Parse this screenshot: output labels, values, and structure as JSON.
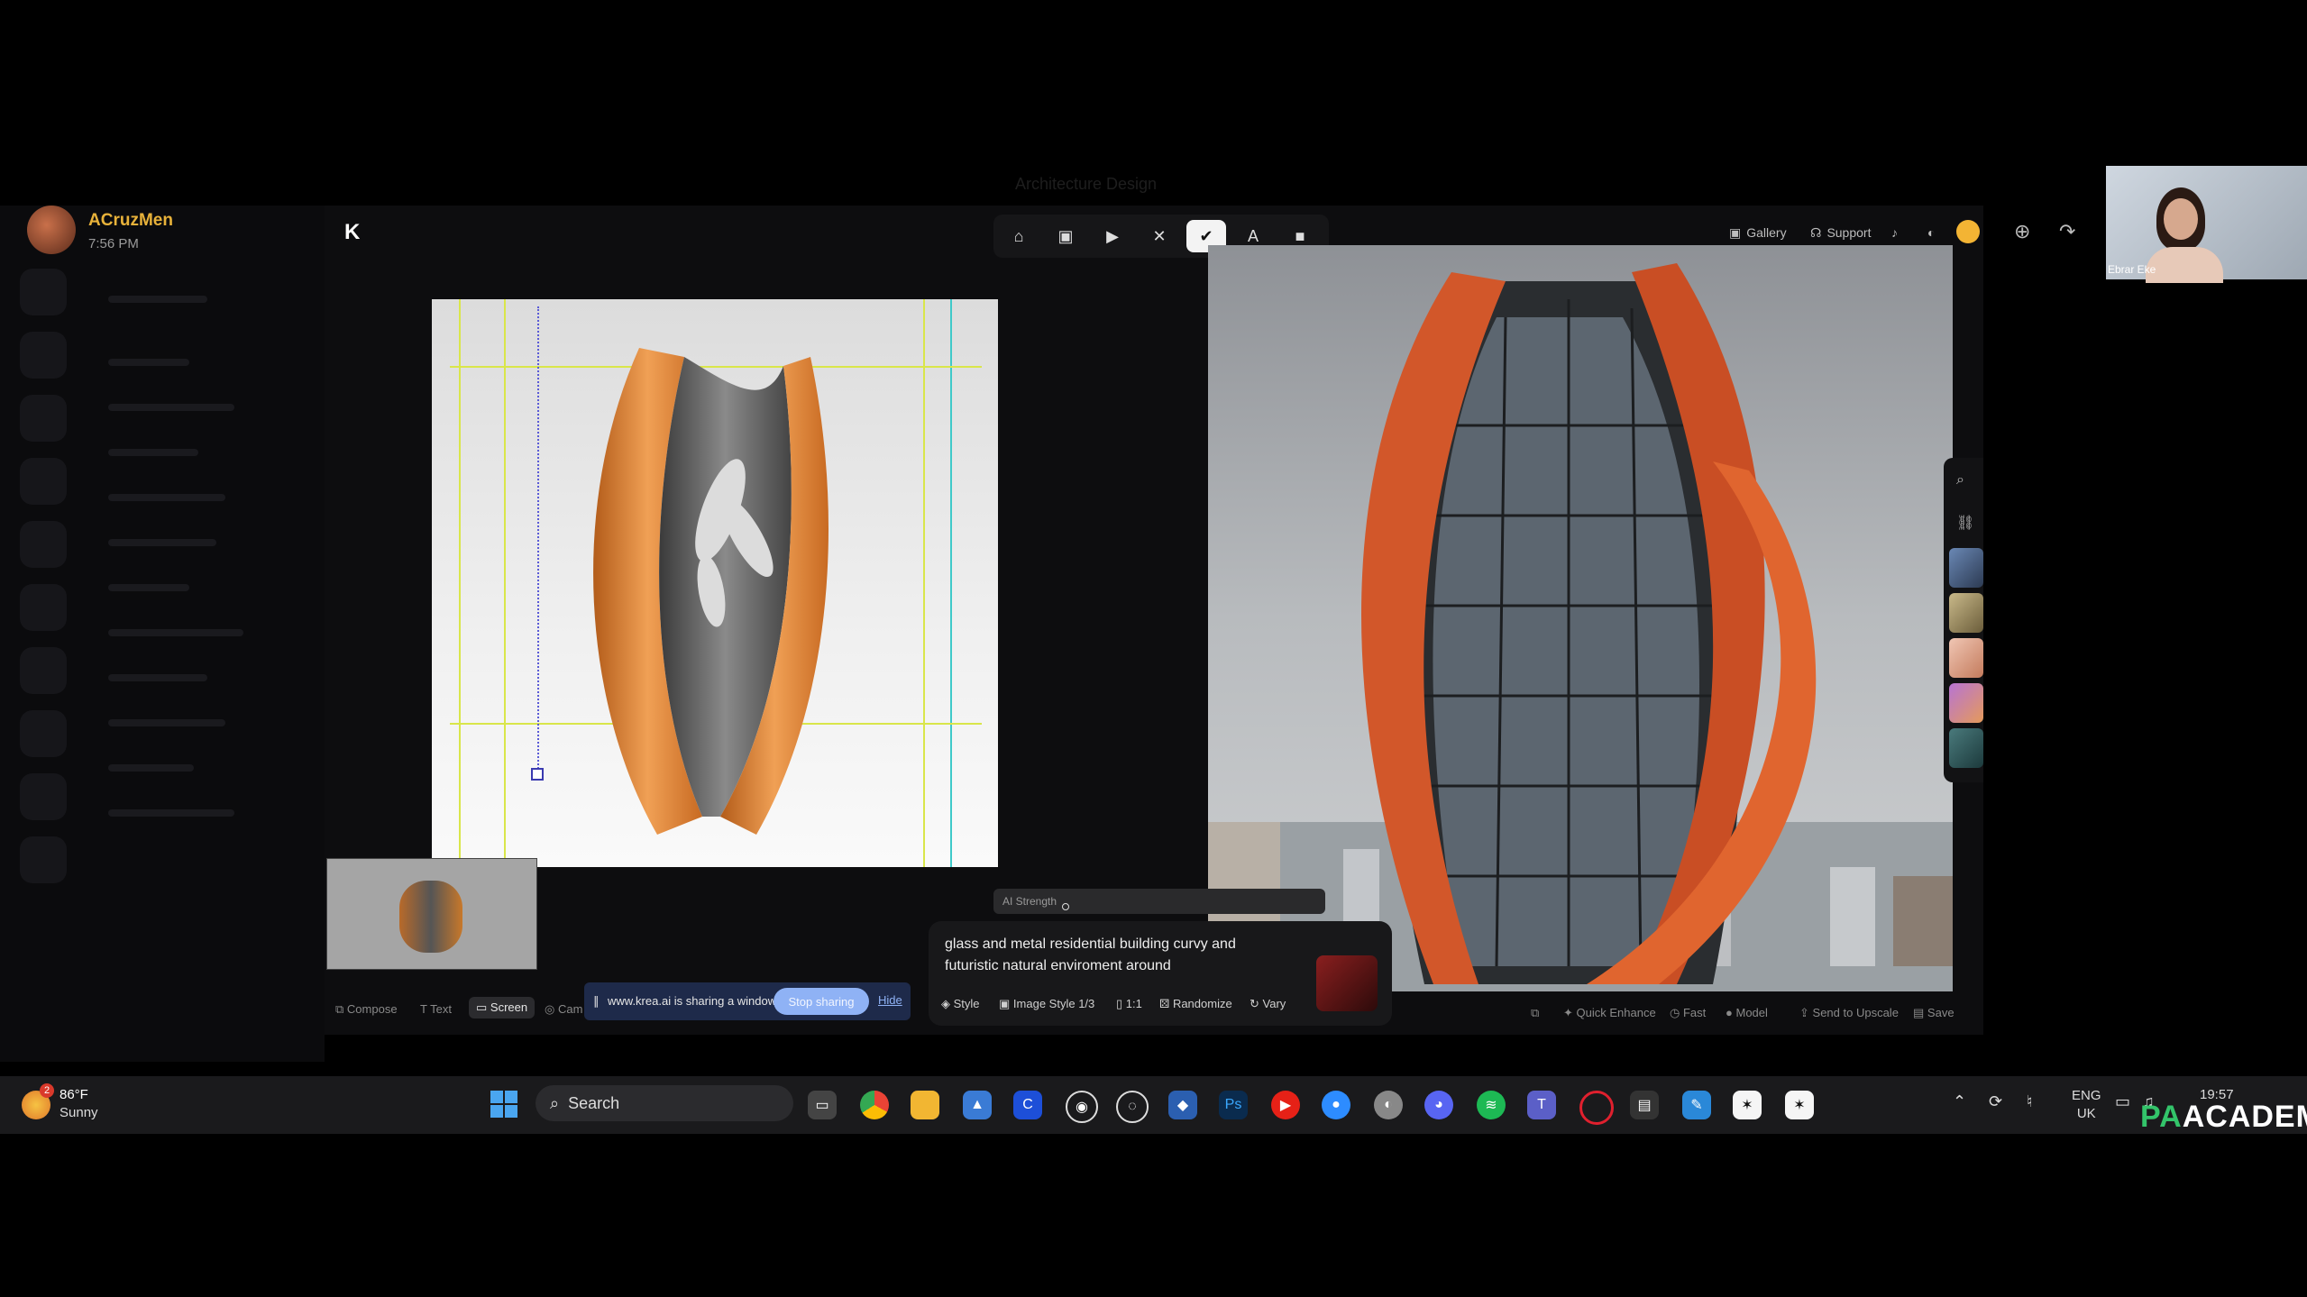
{
  "window_title": "Architecture Design",
  "user": {
    "name": "ACruzMen",
    "time": "7:56 PM"
  },
  "krea": {
    "logo": "K",
    "toolbar": [
      {
        "name": "home",
        "glyph": "⌂"
      },
      {
        "name": "image",
        "glyph": "▣"
      },
      {
        "name": "video",
        "glyph": "▶"
      },
      {
        "name": "enhance",
        "glyph": "✕"
      },
      {
        "name": "realtime",
        "glyph": "✔"
      },
      {
        "name": "text",
        "glyph": "A"
      },
      {
        "name": "assets",
        "glyph": "■"
      }
    ],
    "gallery_label": "Gallery",
    "support_label": "Support",
    "ai_strength_label": "AI Strength",
    "prompt": "glass and metal residential building curvy and futuristic natural enviroment around",
    "prompt_buttons": {
      "style": "Style",
      "image_style": "Image Style",
      "image_style_count": "1/3",
      "ratio": "1:1",
      "randomize": "Randomize",
      "vary": "Vary"
    },
    "bottom_tools": {
      "compose": "Compose",
      "text": "Text",
      "screen": "Screen",
      "cam": "Cam"
    },
    "right_actions": {
      "quick_enhance": "Quick Enhance",
      "fast": "Fast",
      "model": "Model",
      "send_upscale": "Send to Upscale",
      "save": "Save"
    },
    "share_banner": {
      "message": "www.krea.ai is sharing a window.",
      "stop": "Stop sharing",
      "hide": "Hide"
    }
  },
  "webcam": {
    "name": "Ebrar Eke"
  },
  "taskbar": {
    "temp": "86°F",
    "condition": "Sunny",
    "weather_badge": "2",
    "search": "Search",
    "lang_line1": "ENG",
    "lang_line2": "UK",
    "time": "19:57",
    "icons": [
      "file-explorer-icon",
      "chrome-icon",
      "folder-icon",
      "photos-icon",
      "cursor-icon",
      "github-icon",
      "obs-icon",
      "app-icon",
      "photoshop-icon",
      "youtube-icon",
      "zoom-icon",
      "steam-icon",
      "discord-icon",
      "spotify-icon",
      "teams-icon",
      "opera-icon",
      "terminal-icon",
      "paint-icon",
      "blender-icon",
      "blender2-icon"
    ]
  },
  "watermark": {
    "pa": "PA",
    "academy": "ACADEMY"
  },
  "colors": {
    "accent_orange": "#e8662a",
    "sun": "#f3b434",
    "user_name": "#e8b23a",
    "share_blue": "#8fb2f5"
  }
}
